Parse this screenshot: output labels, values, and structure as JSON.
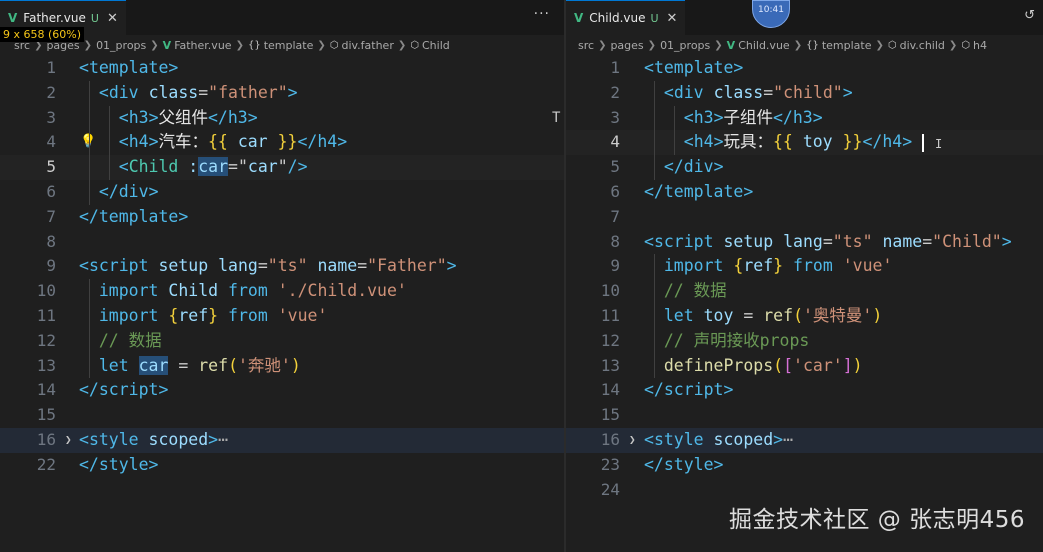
{
  "overlay_badge": "9 x 658 (60%)",
  "timer_badge": "10:41",
  "watermark": "掘金技术社区 @ 张志明456",
  "left": {
    "tab": {
      "filename": "Father.vue",
      "status": "U"
    },
    "breadcrumb": [
      "src",
      "pages",
      "01_props",
      "Father.vue",
      "template",
      "div.father",
      "Child"
    ],
    "lines": [
      {
        "n": "1",
        "t": [
          [
            "tag",
            "<"
          ],
          [
            "tn",
            "template"
          ],
          [
            "tag",
            ">"
          ]
        ]
      },
      {
        "n": "2",
        "t": [
          [
            "op",
            "  "
          ],
          [
            "tag",
            "<"
          ],
          [
            "tn",
            "div"
          ],
          [
            "op",
            " "
          ],
          [
            "attr",
            "class"
          ],
          [
            "op",
            "="
          ],
          [
            "str",
            "\"father\""
          ],
          [
            "tag",
            ">"
          ]
        ]
      },
      {
        "n": "3",
        "t": [
          [
            "op",
            "    "
          ],
          [
            "tag",
            "<"
          ],
          [
            "tn",
            "h3"
          ],
          [
            "tag",
            ">"
          ],
          [
            "text",
            "父组件"
          ],
          [
            "tag",
            "</"
          ],
          [
            "tn",
            "h3"
          ],
          [
            "tag",
            ">"
          ]
        ]
      },
      {
        "n": "4",
        "t": [
          [
            "op",
            "    "
          ],
          [
            "tag",
            "<"
          ],
          [
            "tn",
            "h4"
          ],
          [
            "tag",
            ">"
          ],
          [
            "text",
            "汽车："
          ],
          [
            "br",
            "{{"
          ],
          [
            "op",
            " "
          ],
          [
            "id",
            "car"
          ],
          [
            "op",
            " "
          ],
          [
            "br",
            "}}"
          ],
          [
            "tag",
            "</"
          ],
          [
            "tn",
            "h4"
          ],
          [
            "tag",
            ">"
          ]
        ]
      },
      {
        "n": "5",
        "t": [
          [
            "op",
            "    "
          ],
          [
            "tag",
            "<"
          ],
          [
            "comp",
            "Child"
          ],
          [
            "op",
            " "
          ],
          [
            "attr",
            ":"
          ],
          [
            "sel",
            "car"
          ],
          [
            "op",
            "="
          ],
          [
            "op",
            "\""
          ],
          [
            "id",
            "car"
          ],
          [
            "op",
            "\""
          ],
          [
            "tag",
            "/>"
          ]
        ]
      },
      {
        "n": "6",
        "t": [
          [
            "op",
            "  "
          ],
          [
            "tag",
            "</"
          ],
          [
            "tn",
            "div"
          ],
          [
            "tag",
            ">"
          ]
        ]
      },
      {
        "n": "7",
        "t": [
          [
            "tag",
            "</"
          ],
          [
            "tn",
            "template"
          ],
          [
            "tag",
            ">"
          ]
        ]
      },
      {
        "n": "8",
        "t": []
      },
      {
        "n": "9",
        "t": [
          [
            "tag",
            "<"
          ],
          [
            "tn",
            "script"
          ],
          [
            "op",
            " "
          ],
          [
            "attr",
            "setup"
          ],
          [
            "op",
            " "
          ],
          [
            "attr",
            "lang"
          ],
          [
            "op",
            "="
          ],
          [
            "str",
            "\"ts\""
          ],
          [
            "op",
            " "
          ],
          [
            "attr",
            "name"
          ],
          [
            "op",
            "="
          ],
          [
            "str",
            "\"Father\""
          ],
          [
            "tag",
            ">"
          ]
        ]
      },
      {
        "n": "10",
        "t": [
          [
            "op",
            "  "
          ],
          [
            "ctl",
            "import"
          ],
          [
            "op",
            " "
          ],
          [
            "id",
            "Child"
          ],
          [
            "op",
            " "
          ],
          [
            "ctl",
            "from"
          ],
          [
            "op",
            " "
          ],
          [
            "str",
            "'./Child.vue'"
          ]
        ]
      },
      {
        "n": "11",
        "t": [
          [
            "op",
            "  "
          ],
          [
            "ctl",
            "import"
          ],
          [
            "op",
            " "
          ],
          [
            "br",
            "{"
          ],
          [
            "id",
            "ref"
          ],
          [
            "br",
            "}"
          ],
          [
            "op",
            " "
          ],
          [
            "ctl",
            "from"
          ],
          [
            "op",
            " "
          ],
          [
            "str",
            "'vue'"
          ]
        ]
      },
      {
        "n": "12",
        "t": [
          [
            "op",
            "  "
          ],
          [
            "com",
            "// 数据"
          ]
        ]
      },
      {
        "n": "13",
        "t": [
          [
            "op",
            "  "
          ],
          [
            "kw",
            "let"
          ],
          [
            "op",
            " "
          ],
          [
            "sel",
            "car"
          ],
          [
            "op",
            " = "
          ],
          [
            "fn",
            "ref"
          ],
          [
            "br",
            "("
          ],
          [
            "str",
            "'奔驰'"
          ],
          [
            "br",
            ")"
          ]
        ]
      },
      {
        "n": "14",
        "t": [
          [
            "tag",
            "</"
          ],
          [
            "tn",
            "script"
          ],
          [
            "tag",
            ">"
          ]
        ]
      },
      {
        "n": "15",
        "t": []
      },
      {
        "n": "16",
        "t": [
          [
            "tag",
            "<"
          ],
          [
            "tn",
            "style"
          ],
          [
            "op",
            " "
          ],
          [
            "attr",
            "scoped"
          ],
          [
            "tag",
            ">"
          ],
          [
            "fold",
            "⋯"
          ]
        ]
      },
      {
        "n": "22",
        "t": [
          [
            "tag",
            "</"
          ],
          [
            "tn",
            "style"
          ],
          [
            "tag",
            ">"
          ]
        ]
      }
    ]
  },
  "right": {
    "tab": {
      "filename": "Child.vue",
      "status": "U"
    },
    "breadcrumb": [
      "src",
      "pages",
      "01_props",
      "Child.vue",
      "template",
      "div.child",
      "h4"
    ],
    "lines": [
      {
        "n": "1",
        "t": [
          [
            "tag",
            "<"
          ],
          [
            "tn",
            "template"
          ],
          [
            "tag",
            ">"
          ]
        ]
      },
      {
        "n": "2",
        "t": [
          [
            "op",
            "  "
          ],
          [
            "tag",
            "<"
          ],
          [
            "tn",
            "div"
          ],
          [
            "op",
            " "
          ],
          [
            "attr",
            "class"
          ],
          [
            "op",
            "="
          ],
          [
            "str",
            "\"child\""
          ],
          [
            "tag",
            ">"
          ]
        ]
      },
      {
        "n": "3",
        "t": [
          [
            "op",
            "    "
          ],
          [
            "tag",
            "<"
          ],
          [
            "tn",
            "h3"
          ],
          [
            "tag",
            ">"
          ],
          [
            "text",
            "子组件"
          ],
          [
            "tag",
            "</"
          ],
          [
            "tn",
            "h3"
          ],
          [
            "tag",
            ">"
          ]
        ]
      },
      {
        "n": "4",
        "t": [
          [
            "op",
            "    "
          ],
          [
            "tag",
            "<"
          ],
          [
            "tn",
            "h4"
          ],
          [
            "tag",
            ">"
          ],
          [
            "text",
            "玩具："
          ],
          [
            "br",
            "{{"
          ],
          [
            "op",
            " "
          ],
          [
            "id",
            "toy"
          ],
          [
            "op",
            " "
          ],
          [
            "br",
            "}}"
          ],
          [
            "tag",
            "</"
          ],
          [
            "tn",
            "h4"
          ],
          [
            "tag",
            ">"
          ]
        ]
      },
      {
        "n": "5",
        "t": [
          [
            "op",
            "  "
          ],
          [
            "tag",
            "</"
          ],
          [
            "tn",
            "div"
          ],
          [
            "tag",
            ">"
          ]
        ]
      },
      {
        "n": "6",
        "t": [
          [
            "tag",
            "</"
          ],
          [
            "tn",
            "template"
          ],
          [
            "tag",
            ">"
          ]
        ]
      },
      {
        "n": "7",
        "t": []
      },
      {
        "n": "8",
        "t": [
          [
            "tag",
            "<"
          ],
          [
            "tn",
            "script"
          ],
          [
            "op",
            " "
          ],
          [
            "attr",
            "setup"
          ],
          [
            "op",
            " "
          ],
          [
            "attr",
            "lang"
          ],
          [
            "op",
            "="
          ],
          [
            "str",
            "\"ts\""
          ],
          [
            "op",
            " "
          ],
          [
            "attr",
            "name"
          ],
          [
            "op",
            "="
          ],
          [
            "str",
            "\"Child\""
          ],
          [
            "tag",
            ">"
          ]
        ]
      },
      {
        "n": "9",
        "t": [
          [
            "op",
            "  "
          ],
          [
            "ctl",
            "import"
          ],
          [
            "op",
            " "
          ],
          [
            "br",
            "{"
          ],
          [
            "id",
            "ref"
          ],
          [
            "br",
            "}"
          ],
          [
            "op",
            " "
          ],
          [
            "ctl",
            "from"
          ],
          [
            "op",
            " "
          ],
          [
            "str",
            "'vue'"
          ]
        ]
      },
      {
        "n": "10",
        "t": [
          [
            "op",
            "  "
          ],
          [
            "com",
            "// 数据"
          ]
        ]
      },
      {
        "n": "11",
        "t": [
          [
            "op",
            "  "
          ],
          [
            "kw",
            "let"
          ],
          [
            "op",
            " "
          ],
          [
            "id",
            "toy"
          ],
          [
            "op",
            " = "
          ],
          [
            "fn",
            "ref"
          ],
          [
            "br",
            "("
          ],
          [
            "str",
            "'奥特曼'"
          ],
          [
            "br",
            ")"
          ]
        ]
      },
      {
        "n": "12",
        "t": [
          [
            "op",
            "  "
          ],
          [
            "com",
            "// 声明接收props"
          ]
        ]
      },
      {
        "n": "13",
        "t": [
          [
            "op",
            "  "
          ],
          [
            "fn",
            "defineProps"
          ],
          [
            "br",
            "("
          ],
          [
            "br2",
            "["
          ],
          [
            "str",
            "'car'"
          ],
          [
            "br2",
            "]"
          ],
          [
            "br",
            ")"
          ]
        ]
      },
      {
        "n": "14",
        "t": [
          [
            "tag",
            "</"
          ],
          [
            "tn",
            "script"
          ],
          [
            "tag",
            ">"
          ]
        ]
      },
      {
        "n": "15",
        "t": []
      },
      {
        "n": "16",
        "t": [
          [
            "tag",
            "<"
          ],
          [
            "tn",
            "style"
          ],
          [
            "op",
            " "
          ],
          [
            "attr",
            "scoped"
          ],
          [
            "tag",
            ">"
          ],
          [
            "fold",
            "⋯"
          ]
        ]
      },
      {
        "n": "23",
        "t": [
          [
            "tag",
            "</"
          ],
          [
            "tn",
            "style"
          ],
          [
            "tag",
            ">"
          ]
        ]
      },
      {
        "n": "24",
        "t": []
      }
    ]
  }
}
